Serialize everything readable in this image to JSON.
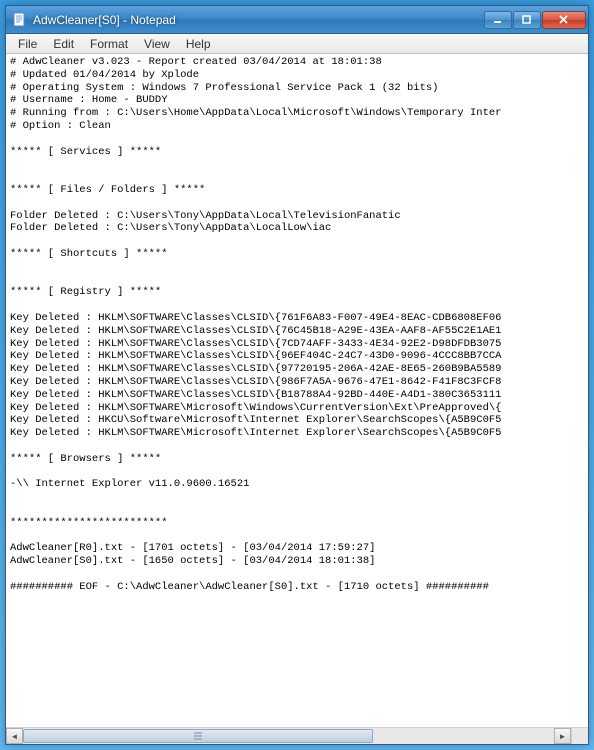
{
  "window": {
    "title": "AdwCleaner[S0] - Notepad"
  },
  "menu": {
    "file": "File",
    "edit": "Edit",
    "format": "Format",
    "view": "View",
    "help": "Help"
  },
  "content": {
    "text": "# AdwCleaner v3.023 - Report created 03/04/2014 at 18:01:38\n# Updated 01/04/2014 by Xplode\n# Operating System : Windows 7 Professional Service Pack 1 (32 bits)\n# Username : Home - BUDDY\n# Running from : C:\\Users\\Home\\AppData\\Local\\Microsoft\\Windows\\Temporary Inter\n# Option : Clean\n\n***** [ Services ] *****\n\n\n***** [ Files / Folders ] *****\n\nFolder Deleted : C:\\Users\\Tony\\AppData\\Local\\TelevisionFanatic\nFolder Deleted : C:\\Users\\Tony\\AppData\\LocalLow\\iac\n\n***** [ Shortcuts ] *****\n\n\n***** [ Registry ] *****\n\nKey Deleted : HKLM\\SOFTWARE\\Classes\\CLSID\\{761F6A83-F007-49E4-8EAC-CDB6808EF06\nKey Deleted : HKLM\\SOFTWARE\\Classes\\CLSID\\{76C45B18-A29E-43EA-AAF8-AF55C2E1AE1\nKey Deleted : HKLM\\SOFTWARE\\Classes\\CLSID\\{7CD74AFF-3433-4E34-92E2-D98DFDB3075\nKey Deleted : HKLM\\SOFTWARE\\Classes\\CLSID\\{96EF404C-24C7-43D0-9096-4CCC8BB7CCA\nKey Deleted : HKLM\\SOFTWARE\\Classes\\CLSID\\{97720195-206A-42AE-8E65-260B9BA5589\nKey Deleted : HKLM\\SOFTWARE\\Classes\\CLSID\\{986F7A5A-9676-47E1-8642-F41F8C3FCF8\nKey Deleted : HKLM\\SOFTWARE\\Classes\\CLSID\\{B18788A4-92BD-440E-A4D1-380C3653111\nKey Deleted : HKLM\\SOFTWARE\\Microsoft\\Windows\\CurrentVersion\\Ext\\PreApproved\\{\nKey Deleted : HKCU\\Software\\Microsoft\\Internet Explorer\\SearchScopes\\{A5B9C0F5\nKey Deleted : HKLM\\SOFTWARE\\Microsoft\\Internet Explorer\\SearchScopes\\{A5B9C0F5\n\n***** [ Browsers ] *****\n\n-\\\\ Internet Explorer v11.0.9600.16521\n\n\n*************************\n\nAdwCleaner[R0].txt - [1701 octets] - [03/04/2014 17:59:27]\nAdwCleaner[S0].txt - [1650 octets] - [03/04/2014 18:01:38]\n\n########## EOF - C:\\AdwCleaner\\AdwCleaner[S0].txt - [1710 octets] ##########"
  }
}
